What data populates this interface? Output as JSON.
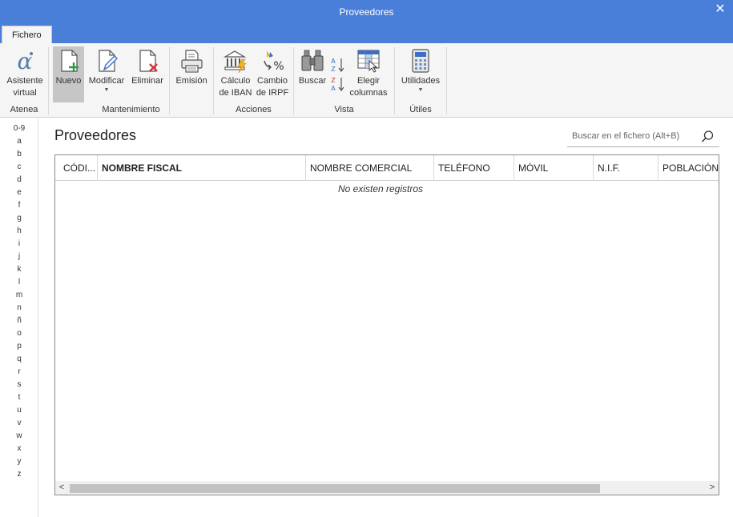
{
  "window": {
    "title": "Proveedores",
    "close_glyph": "✕"
  },
  "tabs": [
    {
      "label": "Fichero"
    }
  ],
  "ribbon": {
    "groups": [
      {
        "label": "Atenea"
      },
      {
        "label": "Mantenimiento"
      },
      {
        "label": "Acciones"
      },
      {
        "label": "Vista"
      },
      {
        "label": "Útiles"
      }
    ],
    "buttons": {
      "asistente": {
        "line1": "Asistente",
        "line2": "virtual",
        "icon": "alpha-assistant-icon"
      },
      "nuevo": {
        "line1": "Nuevo",
        "icon": "new-document-icon"
      },
      "modificar": {
        "line1": "Modificar",
        "icon": "edit-document-icon"
      },
      "eliminar": {
        "line1": "Eliminar",
        "icon": "delete-document-icon"
      },
      "emision": {
        "line1": "Emisión",
        "icon": "printer-icon"
      },
      "calculo_iban": {
        "line1": "Cálculo",
        "line2": "de IBAN",
        "icon": "bank-icon"
      },
      "cambio_irpf": {
        "line1": "Cambio",
        "line2": "de IRPF",
        "icon": "percent-icon"
      },
      "buscar": {
        "line1": "Buscar",
        "icon": "binoculars-icon"
      },
      "elegir_columnas": {
        "line1": "Elegir",
        "line2": "columnas",
        "icon": "columns-icon"
      },
      "utilidades": {
        "line1": "Utilidades",
        "icon": "calculator-icon"
      }
    },
    "sort_az": {
      "top": "A",
      "bottom": "Z"
    },
    "sort_za": {
      "top": "Z",
      "bottom": "A"
    }
  },
  "alphabet": [
    "0-9",
    "a",
    "b",
    "c",
    "d",
    "e",
    "f",
    "g",
    "h",
    "i",
    "j",
    "k",
    "l",
    "m",
    "n",
    "ñ",
    "o",
    "p",
    "q",
    "r",
    "s",
    "t",
    "u",
    "v",
    "w",
    "x",
    "y",
    "z"
  ],
  "main": {
    "title": "Proveedores",
    "search": {
      "placeholder": "Buscar en el fichero (Alt+B)"
    },
    "columns": [
      "CÓDI...",
      "NOMBRE FISCAL",
      "NOMBRE COMERCIAL",
      "TELÉFONO",
      "MÓVIL",
      "N.I.F.",
      "POBLACIÓN"
    ],
    "empty_message": "No existen registros"
  },
  "colors": {
    "accent": "#4a7fd9",
    "ribbon_bg": "#f5f5f5",
    "pressed": "#c6c6c6"
  }
}
